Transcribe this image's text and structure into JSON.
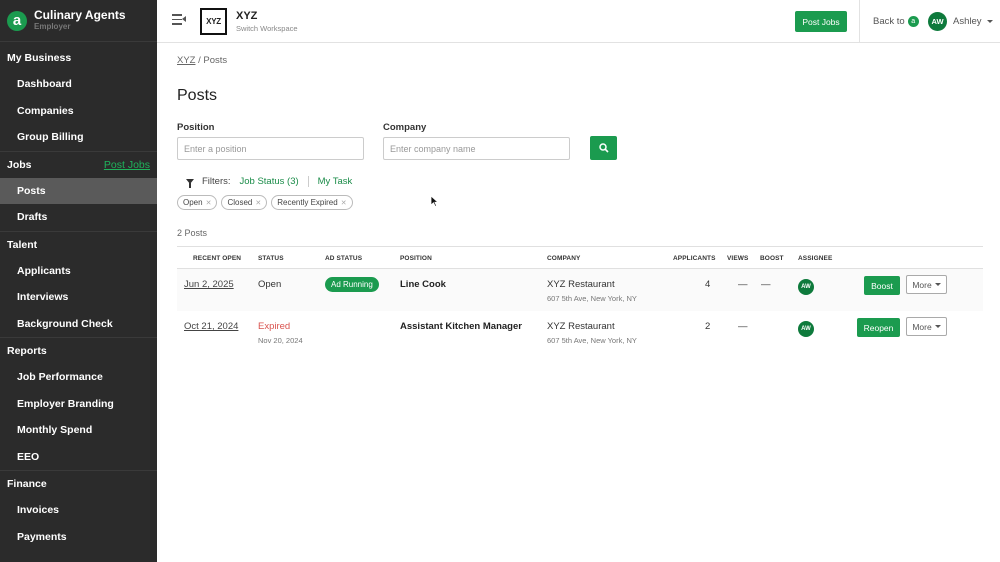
{
  "brand": {
    "logo_letter": "a",
    "name": "Culinary Agents",
    "sub": "Employer"
  },
  "sidebar": {
    "sections": [
      {
        "title": "My Business",
        "items": [
          "Dashboard",
          "Companies",
          "Group Billing"
        ]
      },
      {
        "title": "Jobs",
        "link": "Post Jobs",
        "items": [
          "Posts",
          "Drafts"
        ]
      },
      {
        "title": "Talent",
        "items": [
          "Applicants",
          "Interviews",
          "Background Check"
        ]
      },
      {
        "title": "Reports",
        "items": [
          "Job Performance",
          "Employer Branding",
          "Monthly Spend",
          "EEO"
        ]
      },
      {
        "title": "Finance",
        "items": [
          "Invoices",
          "Payments"
        ]
      }
    ],
    "active_item": "Posts"
  },
  "header": {
    "workspace_logo": "XYZ",
    "workspace_name": "XYZ",
    "workspace_sub": "Switch Workspace",
    "post_jobs_label": "Post Jobs",
    "back_to_label": "Back to",
    "back_badge": "a",
    "avatar_initials": "AW",
    "user_name": "Ashley"
  },
  "breadcrumb": {
    "root": "XYZ",
    "sep": "/",
    "current": "Posts"
  },
  "page": {
    "title": "Posts"
  },
  "search": {
    "position_label": "Position",
    "position_placeholder": "Enter a position",
    "company_label": "Company",
    "company_placeholder": "Enter company name"
  },
  "filters": {
    "label": "Filters:",
    "job_status": "Job Status (3)",
    "my_task": "My Task",
    "chips": [
      "Open",
      "Closed",
      "Recently Expired"
    ]
  },
  "results": {
    "count_text": "2 Posts"
  },
  "table": {
    "columns": [
      "RECENT OPEN",
      "STATUS",
      "AD STATUS",
      "POSITION",
      "COMPANY",
      "APPLICANTS",
      "VIEWS",
      "BOOST",
      "ASSIGNEE"
    ],
    "rows": [
      {
        "recent_open": "Jun 2, 2025",
        "status": "Open",
        "status_sub": "",
        "ad_status": "Ad Running",
        "position": "Line Cook",
        "company": "XYZ Restaurant",
        "address": "607 5th Ave, New York, NY",
        "applicants": "4",
        "views": "—",
        "boost": "—",
        "assignee": "AW",
        "action": "Boost",
        "more": "More"
      },
      {
        "recent_open": "Oct 21, 2024",
        "status": "Expired",
        "status_sub": "Nov 20, 2024",
        "ad_status": "",
        "position": "Assistant Kitchen Manager",
        "company": "XYZ Restaurant",
        "address": "607 5th Ave, New York, NY",
        "applicants": "2",
        "views": "—",
        "boost": "",
        "assignee": "AW",
        "action": "Reopen",
        "more": "More"
      }
    ]
  },
  "colors": {
    "accent": "#1b9b4f",
    "sidebar_bg": "#2b2b2b",
    "expired": "#d9534f"
  }
}
